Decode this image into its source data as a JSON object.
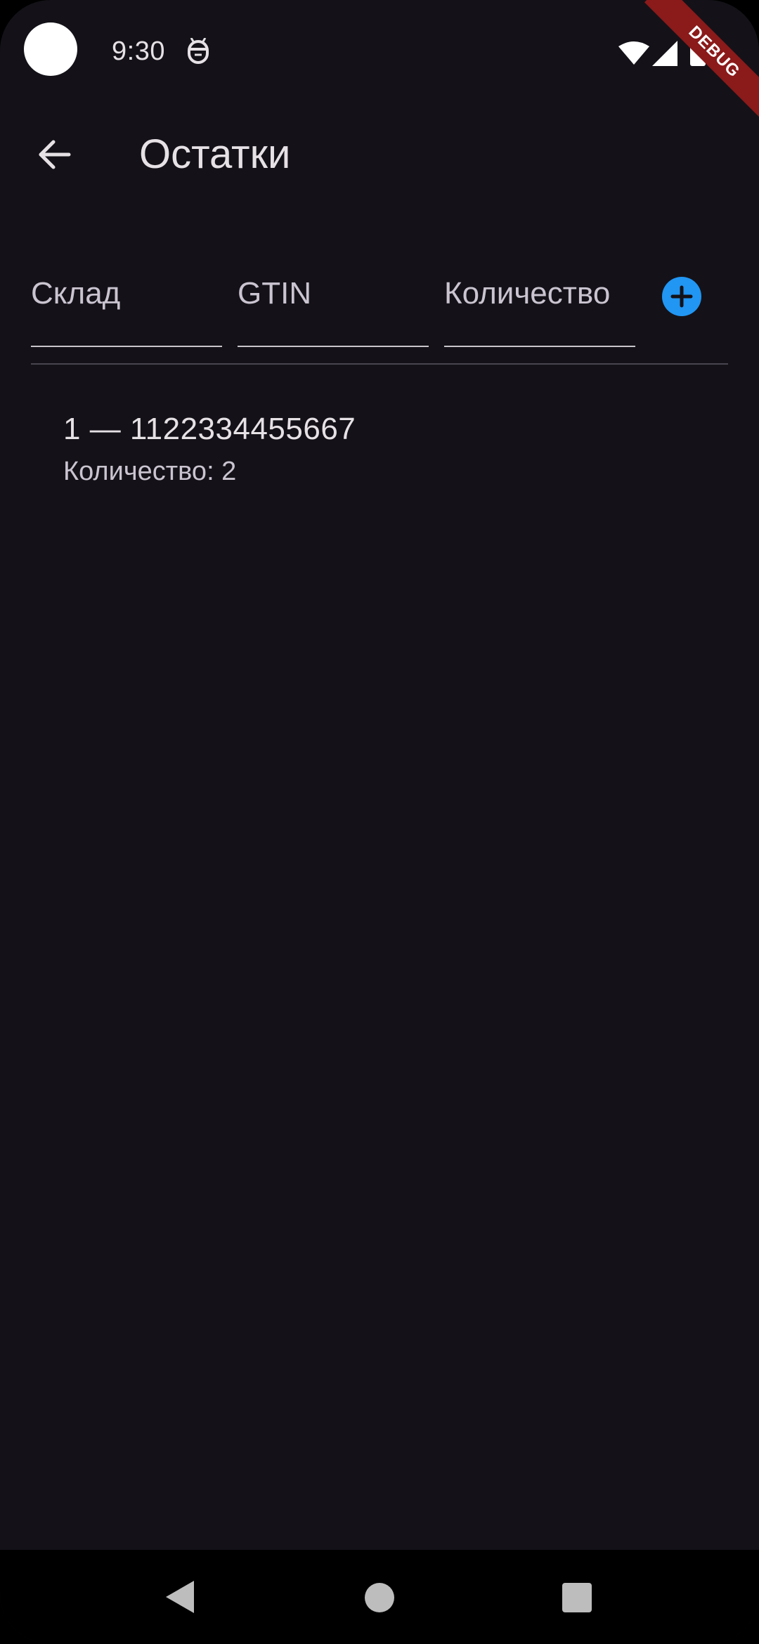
{
  "status_bar": {
    "time": "9:30",
    "icons": [
      "notification-icon",
      "wifi-icon",
      "signal-icon",
      "battery-icon"
    ]
  },
  "debug_banner": "DEBUG",
  "app_bar": {
    "title": "Остатки",
    "back_icon": "arrow-back-icon"
  },
  "form": {
    "warehouse_placeholder": "Склад",
    "gtin_placeholder": "GTIN",
    "quantity_placeholder": "Количество",
    "add_icon": "add-circle-icon"
  },
  "items": [
    {
      "title": "1 — 1122334455667",
      "subtitle": "Количество: 2"
    }
  ],
  "colors": {
    "background": "#141218",
    "accent": "#2196f3",
    "text_primary": "#e6e1e5",
    "text_secondary": "#cac4d0",
    "debug_ribbon": "#8b1a1a"
  }
}
